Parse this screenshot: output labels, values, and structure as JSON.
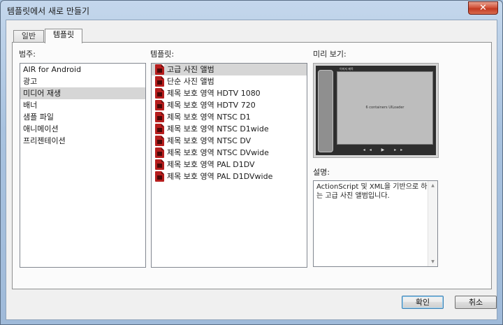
{
  "window": {
    "title": "템플릿에서 새로 만들기"
  },
  "tabs": [
    {
      "label": "일반"
    },
    {
      "label": "템플릿"
    }
  ],
  "categories": {
    "label": "범주:",
    "items": [
      {
        "label": "AIR for Android"
      },
      {
        "label": "광고"
      },
      {
        "label": "미디어 재생"
      },
      {
        "label": "배너"
      },
      {
        "label": "샘플 파일"
      },
      {
        "label": "애니메이션"
      },
      {
        "label": "프리젠테이션"
      }
    ],
    "selected_index": 2
  },
  "templates": {
    "label": "템플릿:",
    "items": [
      {
        "label": "고급 사진 앨범"
      },
      {
        "label": "단순 사진 앨범"
      },
      {
        "label": "제목 보호 영역 HDTV 1080"
      },
      {
        "label": "제목 보호 영역 HDTV 720"
      },
      {
        "label": "제목 보호 영역 NTSC D1"
      },
      {
        "label": "제목 보호 영역 NTSC D1wide"
      },
      {
        "label": "제목 보호 영역 NTSC DV"
      },
      {
        "label": "제목 보호 영역 NTSC DVwide"
      },
      {
        "label": "제목 보호 영역 PAL D1DV"
      },
      {
        "label": "제목 보호 영역 PAL D1DVwide"
      }
    ],
    "selected_index": 0,
    "icon": "fla-file-icon"
  },
  "preview": {
    "label": "미리 보기:",
    "top_title": "이미지 제목",
    "caption": "6 containers UILoader",
    "controls": "◂◂ ▶ ▸▸"
  },
  "description": {
    "label": "설명:",
    "text": "ActionScript 및 XML을 기반으로 하는 고급 사진 앨범입니다."
  },
  "buttons": {
    "ok": "확인",
    "cancel": "취소"
  },
  "colors": {
    "selection": "#d6d6d6",
    "icon_red": "#b61e1e",
    "close_red": "#c23a22"
  }
}
